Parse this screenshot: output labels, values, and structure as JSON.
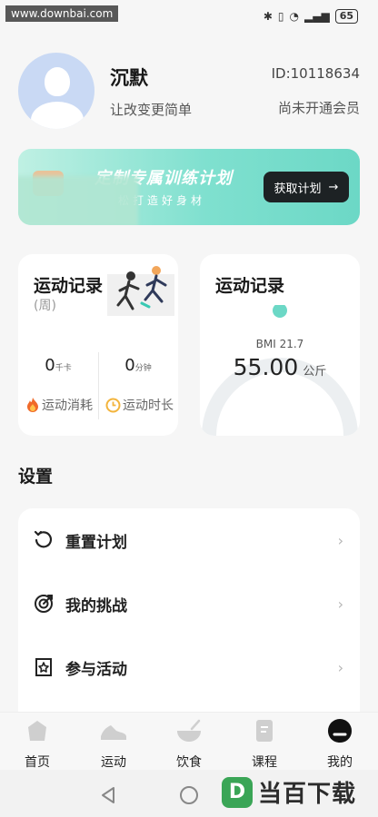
{
  "status_bar": {
    "watermark": "www.downbai.com",
    "battery": "65"
  },
  "profile": {
    "name": "沉默",
    "motto": "让改变更简单",
    "user_id": "ID:10118634",
    "membership": "尚未开通会员"
  },
  "banner": {
    "title": "定制专属训练计划",
    "subtitle": "松打造好身材",
    "button": "获取计划",
    "button_arrow": "→"
  },
  "exercise_card": {
    "title": "运动记录",
    "period": "(周)",
    "calories_value": "0",
    "calories_unit": "千卡",
    "duration_value": "0",
    "duration_unit": "分钟",
    "calories_label": "运动消耗",
    "duration_label": "运动时长"
  },
  "weight_card": {
    "title": "运动记录",
    "bmi": "BMI 21.7",
    "weight": "55.00",
    "weight_unit": "公斤"
  },
  "settings": {
    "title": "设置",
    "items": [
      {
        "label": "重置计划",
        "icon": "reset-icon"
      },
      {
        "label": "我的挑战",
        "icon": "target-icon"
      },
      {
        "label": "参与活动",
        "icon": "activity-star-icon"
      }
    ]
  },
  "tabs": [
    {
      "label": "首页",
      "icon": "home-icon"
    },
    {
      "label": "运动",
      "icon": "sneaker-icon"
    },
    {
      "label": "饮食",
      "icon": "bowl-icon"
    },
    {
      "label": "课程",
      "icon": "course-icon"
    },
    {
      "label": "我的",
      "icon": "profile-icon"
    }
  ],
  "brand": {
    "logo_letter": "D",
    "text": "当百下载"
  },
  "colors": {
    "accent": "#6cd8c6",
    "banner_button": "#1d2224",
    "gauge_track": "#eceff1"
  }
}
